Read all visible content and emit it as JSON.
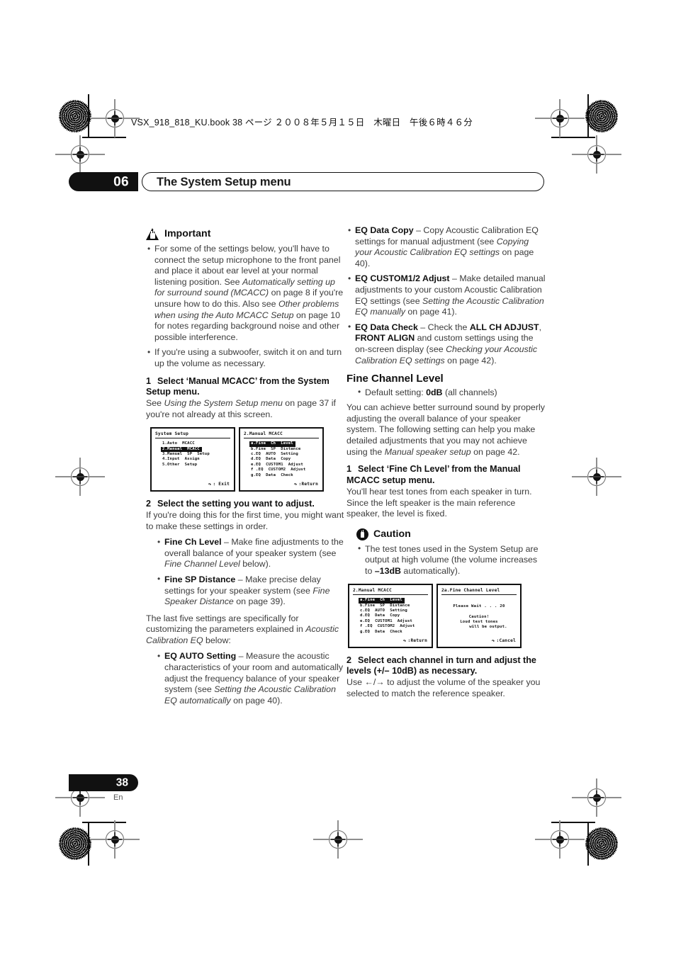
{
  "book_header": "VSX_918_818_KU.book 38 ページ ２００８年５月１５日　木曜日　午後６時４６分",
  "chapter": {
    "number": "06",
    "title": "The System Setup menu"
  },
  "footer": {
    "page": "38",
    "lang": "En"
  },
  "left_column": {
    "important": {
      "icon": "warning-triangle-icon",
      "heading": "Important",
      "bullets": [
        "For some of the settings below, you'll have to connect the setup microphone to the front panel and place it about ear level at your normal listening position. See <i>Automatically setting up for surround sound (MCACC)</i> on page 8 if you're unsure how to do this. Also see <i>Other problems when using the Auto MCACC Setup</i> on page 10 for notes regarding background noise and other possible interference.",
        "If you're using a subwoofer, switch it on and turn up the volume as necessary."
      ]
    },
    "step1": {
      "number": "1",
      "heading": "Select ‘Manual MCACC’ from the System Setup menu.",
      "body": "See <i>Using the System Setup menu</i> on page 37 if you're not already at this screen."
    },
    "screens": [
      {
        "name": "system-setup-screen",
        "title": "System  Setup",
        "items": [
          {
            "text": "1.Auto  MCACC",
            "selected": false
          },
          {
            "text": "2.Manual  MCACC",
            "selected": true
          },
          {
            "text": "3.Manual  SP  Setup",
            "selected": false
          },
          {
            "text": "4.Input  Assign",
            "selected": false
          },
          {
            "text": "5.Other  Setup",
            "selected": false
          }
        ],
        "footer": ": Exit"
      },
      {
        "name": "manual-mcacc-screen",
        "title": "2.Manual  MCACC",
        "items": [
          {
            "text": "a.Fine  Ch  Level",
            "selected": true
          },
          {
            "text": "b.Fine  SP  Distance",
            "selected": false
          },
          {
            "text": "c.EQ  AUTO  Setting",
            "selected": false
          },
          {
            "text": "d.EQ  Data  Copy",
            "selected": false
          },
          {
            "text": "e.EQ  CUSTOM1  Adjust",
            "selected": false
          },
          {
            "text": "f .EQ  CUSTOM2  Adjust",
            "selected": false
          },
          {
            "text": "g.EQ  Data  Check",
            "selected": false
          }
        ],
        "footer": ":Return"
      }
    ],
    "step2": {
      "number": "2",
      "heading": "Select the setting you want to adjust.",
      "body": "If you're doing this for the first time, you might want to make these settings in order.",
      "bullets": [
        "<b>Fine Ch Level</b> – Make fine adjustments to the overall balance of your speaker system (see <i>Fine Channel Level</i> below).",
        "<b>Fine SP Distance</b> – Make precise delay settings for your speaker system (see <i>Fine Speaker Distance</i> on page 39)."
      ]
    },
    "closing_para": "The last five settings are specifically for customizing the parameters explained in <i>Acoustic Calibration EQ</i> below:",
    "closing_bullets": [
      "<b>EQ AUTO Setting</b> – Measure the acoustic characteristics of your room and automatically adjust the frequency balance of your speaker system (see <i>Setting the Acoustic Calibration EQ automatically</i> on page 40)."
    ]
  },
  "right_column": {
    "top_bullets": [
      "<b>EQ Data Copy</b> – Copy Acoustic Calibration EQ settings for manual adjustment (see <i>Copying your Acoustic Calibration EQ settings</i> on page 40).",
      "<b>EQ CUSTOM1/2 Adjust</b> – Make detailed manual adjustments to your custom Acoustic Calibration EQ settings (see <i>Setting the Acoustic Calibration EQ manually</i> on page 41).",
      "<b>EQ Data Check</b> – Check the <b>ALL CH ADJUST</b>, <b>FRONT ALIGN</b> and custom settings using the on-screen display (see <i>Checking your Acoustic Calibration EQ settings</i> on page 42)."
    ],
    "section_title": "Fine Channel Level",
    "default_bullet": "Default setting: <b>0dB</b> (all channels)",
    "intro_para": "You can achieve better surround sound by properly adjusting the overall balance of your speaker system. The following setting can help you make detailed adjustments that you may not achieve using the <i>Manual speaker setup</i> on page 42.",
    "step1": {
      "number": "1",
      "heading": "Select ‘Fine Ch Level’ from the Manual MCACC setup menu.",
      "body": "You'll hear test tones from each speaker in turn. Since the left speaker is the main reference speaker, the level is fixed."
    },
    "caution": {
      "icon": "caution-hand-icon",
      "heading": "Caution",
      "bullets": [
        "The test tones used in the System Setup are output at high volume (the volume increases to <b>–13dB</b> automatically)."
      ]
    },
    "screens": [
      {
        "name": "manual-mcacc-screen-2",
        "title": "2.Manual  MCACC",
        "items": [
          {
            "text": "a.Fine  Ch  Level",
            "selected": true
          },
          {
            "text": "b.Fine  SP  Distance",
            "selected": false
          },
          {
            "text": "c.EQ  AUTO  Setting",
            "selected": false
          },
          {
            "text": "d.EQ  Data  Copy",
            "selected": false
          },
          {
            "text": "e.EQ  CUSTOM1  Adjust",
            "selected": false
          },
          {
            "text": "f .EQ  CUSTOM2  Adjust",
            "selected": false
          },
          {
            "text": "g.EQ  Data  Check",
            "selected": false
          }
        ],
        "footer": ":Return"
      },
      {
        "name": "fine-channel-level-screen",
        "title": "2a.Fine  Channel  Level",
        "wait_text": "Please  Wait . . . 20",
        "caution_line1": "Caution!",
        "caution_line2": "Loud  test  tones",
        "caution_line3": "will  be  output.",
        "footer": ":Cancel"
      }
    ],
    "step2": {
      "number": "2",
      "heading": "Select each channel in turn and adjust the levels (+/– 10dB) as necessary.",
      "body": "Use ←/→ to adjust the volume of the speaker you selected to match the reference speaker."
    }
  }
}
